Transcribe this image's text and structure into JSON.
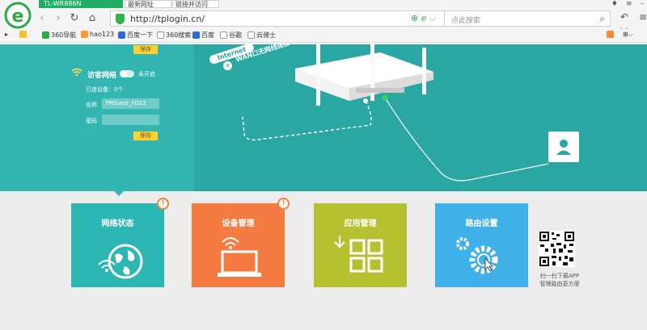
{
  "browser": {
    "tabs": [
      {
        "label": "TL-WR886N"
      },
      {
        "label": "最新网址"
      },
      {
        "label": "链接并访问"
      }
    ],
    "url": "http://tplogin.cn/",
    "search_placeholder": "点此搜索",
    "bookmarks": [
      {
        "label": "360导航"
      },
      {
        "label": "hao123"
      },
      {
        "label": "百度一下"
      },
      {
        "label": "360搜索"
      },
      {
        "label": "百度"
      },
      {
        "label": "谷歌"
      },
      {
        "label": "云骑士"
      }
    ]
  },
  "guest_panel": {
    "save_label": "保存",
    "title": "访客网络",
    "toggle_state": "未开启",
    "connected_devices": "已连设备：0个",
    "name_label": "名称",
    "name_value": "TPGuest_FD12",
    "password_label": "密码",
    "password_value": "",
    "save_label_2": "保存"
  },
  "diagram": {
    "internet_label": "Internet",
    "wan_status": "WAN口无网线连接"
  },
  "tiles": [
    {
      "label": "网络状态",
      "color": "#2cb7b4",
      "alert": "!"
    },
    {
      "label": "设备管理",
      "color": "#f47b41",
      "alert": "!"
    },
    {
      "label": "应用管理",
      "color": "#b5c12f"
    },
    {
      "label": "路由设置",
      "color": "#3fb0e8"
    }
  ],
  "qr": {
    "caption_line1": "扫一扫下载APP",
    "caption_line2": "管理路由更方便"
  }
}
